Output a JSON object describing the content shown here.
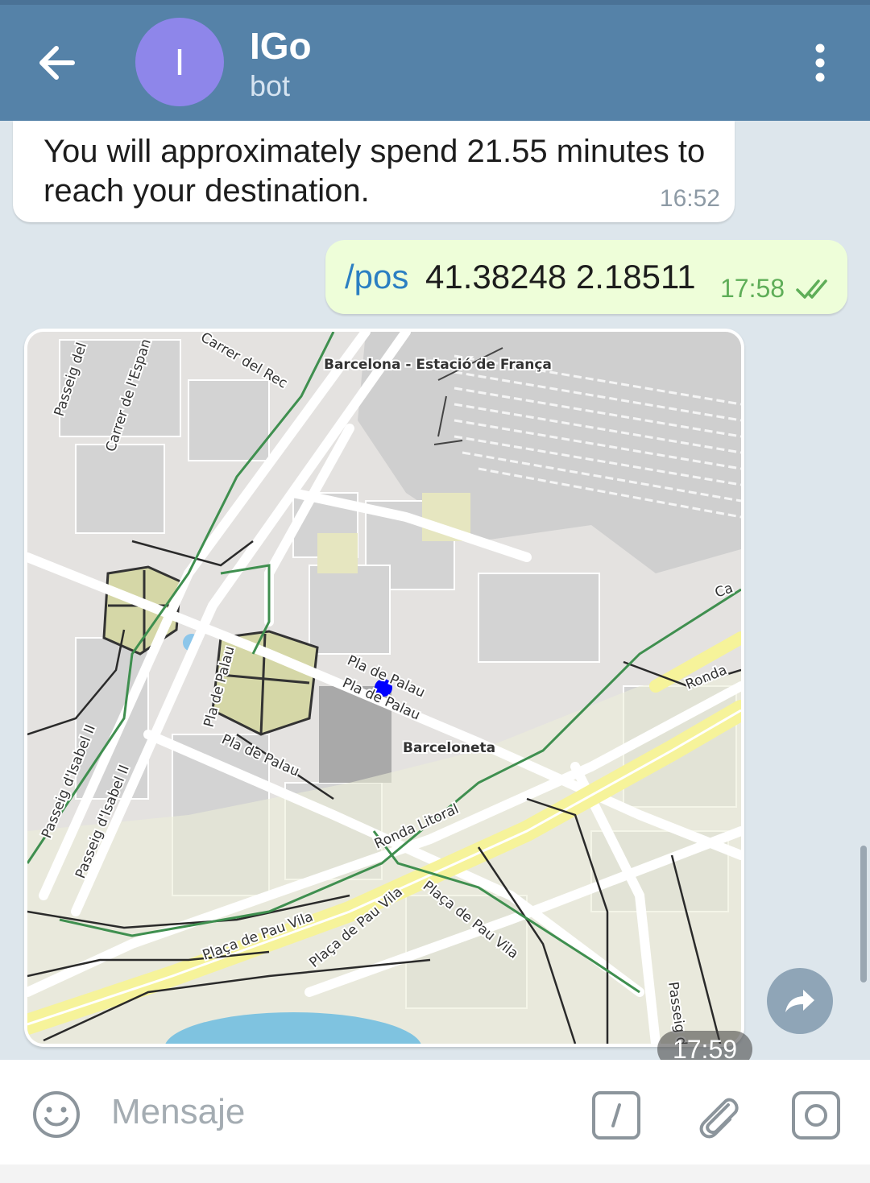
{
  "header": {
    "title": "IGo",
    "subtitle": "bot",
    "avatar_letter": "I",
    "bg_color": "#5582a8"
  },
  "messages": [
    {
      "direction": "incoming",
      "text": "You will approximately spend 21.55 minutes to reach your destination.",
      "time": "16:52"
    },
    {
      "direction": "outgoing",
      "command": "/pos",
      "args": "41.38248 2.18511",
      "time": "17:58",
      "status": "read"
    },
    {
      "direction": "incoming",
      "type": "location-map",
      "time": "17:59",
      "map_labels": {
        "station": "Barcelona - Estació de França",
        "barceloneta": "Barceloneta",
        "ronda_litoral": "Ronda Litoral",
        "ronda_right": "Ronda",
        "pla_palau_1": "Pla de Palau",
        "pla_palau_2": "Pla de Palau",
        "pla_palau_3": "Pla de Palau",
        "pla_palau_4": "Pla de Palau",
        "pau_vila_1": "Plaça de Pau Vila",
        "pau_vila_2": "Plaça de Pau Vila",
        "pau_vila_3": "Plaça de Pau Vila",
        "isabel_1": "Passeig d'Isabel II",
        "isabel_2": "Passeig d'Isabel II",
        "carrer_rec": "Carrer del Rec",
        "carrer_espan": "Carrer de l'Espan",
        "passeig_del": "Passeig del",
        "passeig_right": "Passeig d",
        "ca": "Ca"
      }
    }
  ],
  "input": {
    "placeholder": "Mensaje"
  },
  "icons": {
    "back": "arrow-left-icon",
    "menu": "more-vertical-icon",
    "share": "share-icon",
    "emoji": "emoji-icon",
    "command": "slash-command-icon",
    "attach": "paperclip-icon",
    "camera": "camera-icon",
    "read": "double-check-icon"
  },
  "colors": {
    "chat_bg": "#dde6ec",
    "outgoing_bubble": "#eefed9",
    "link": "#2b7fc2",
    "read_check": "#5fae58",
    "map_marker": "#0000ff"
  }
}
